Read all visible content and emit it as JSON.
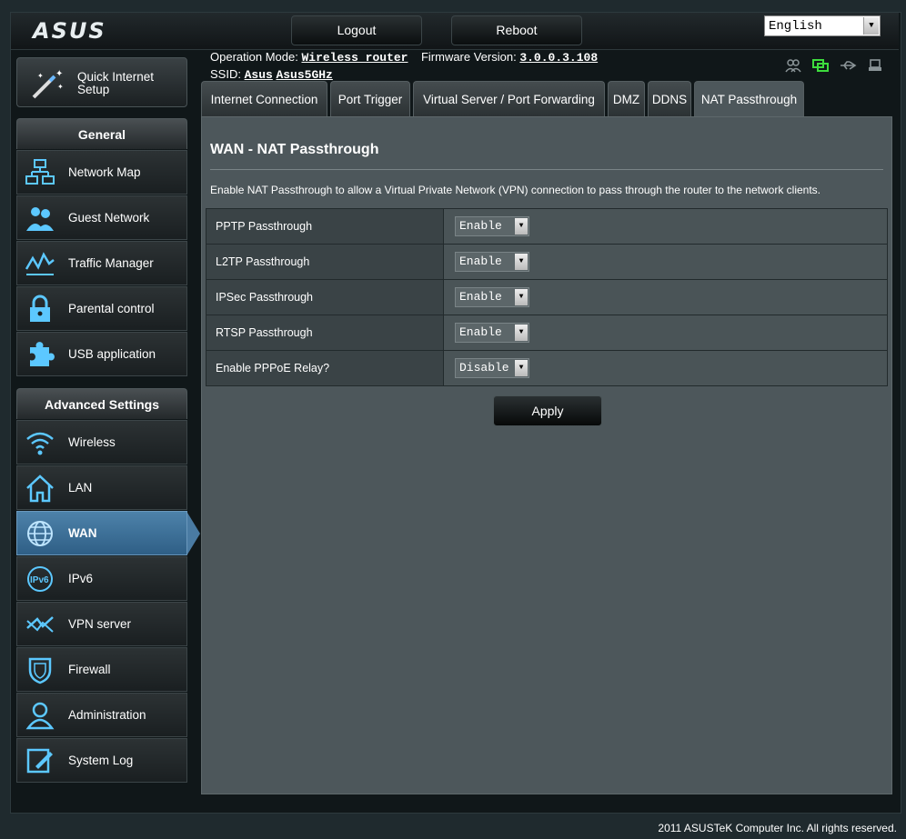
{
  "brand": {
    "logo": "ASUS"
  },
  "header": {
    "logout_label": "Logout",
    "reboot_label": "Reboot",
    "language": "English",
    "operation_mode_label": "Operation Mode:",
    "operation_mode_value": "Wireless router",
    "firmware_label": "Firmware Version:",
    "firmware_value": "3.0.0.3.108",
    "ssid_label": "SSID:",
    "ssid_1": "Asus",
    "ssid_2": "Asus5GHz"
  },
  "sidebar": {
    "qis_label": "Quick Internet Setup",
    "general_header": "General",
    "general_items": [
      {
        "label": "Network Map",
        "icon": "network-map-icon"
      },
      {
        "label": "Guest Network",
        "icon": "guest-network-icon"
      },
      {
        "label": "Traffic Manager",
        "icon": "traffic-manager-icon"
      },
      {
        "label": "Parental control",
        "icon": "lock-icon"
      },
      {
        "label": "USB application",
        "icon": "puzzle-icon"
      }
    ],
    "advanced_header": "Advanced Settings",
    "advanced_items": [
      {
        "label": "Wireless",
        "icon": "wifi-icon"
      },
      {
        "label": "LAN",
        "icon": "home-icon"
      },
      {
        "label": "WAN",
        "icon": "globe-icon"
      },
      {
        "label": "IPv6",
        "icon": "ipv6-icon"
      },
      {
        "label": "VPN server",
        "icon": "vpn-icon"
      },
      {
        "label": "Firewall",
        "icon": "shield-icon"
      },
      {
        "label": "Administration",
        "icon": "user-icon"
      },
      {
        "label": "System Log",
        "icon": "edit-log-icon"
      }
    ]
  },
  "tabs": [
    {
      "label": "Internet Connection"
    },
    {
      "label": "Port Trigger"
    },
    {
      "label": "Virtual Server / Port Forwarding"
    },
    {
      "label": "DMZ"
    },
    {
      "label": "DDNS"
    },
    {
      "label": "NAT Passthrough"
    }
  ],
  "main": {
    "title": "WAN - NAT Passthrough",
    "description": "Enable NAT Passthrough to allow a Virtual Private Network (VPN) connection to pass through the router to the network clients.",
    "rows": [
      {
        "label": "PPTP Passthrough",
        "value": "Enable"
      },
      {
        "label": "L2TP Passthrough",
        "value": "Enable"
      },
      {
        "label": "IPSec Passthrough",
        "value": "Enable"
      },
      {
        "label": "RTSP Passthrough",
        "value": "Enable"
      },
      {
        "label": "Enable PPPoE Relay?",
        "value": "Disable"
      }
    ],
    "apply_label": "Apply"
  },
  "footer": {
    "copyright": "2011 ASUSTeK Computer Inc. All rights reserved."
  },
  "colors": {
    "active_nav": "#3f719a",
    "panel": "#4d575b",
    "accent_green": "#3ddc3d"
  }
}
